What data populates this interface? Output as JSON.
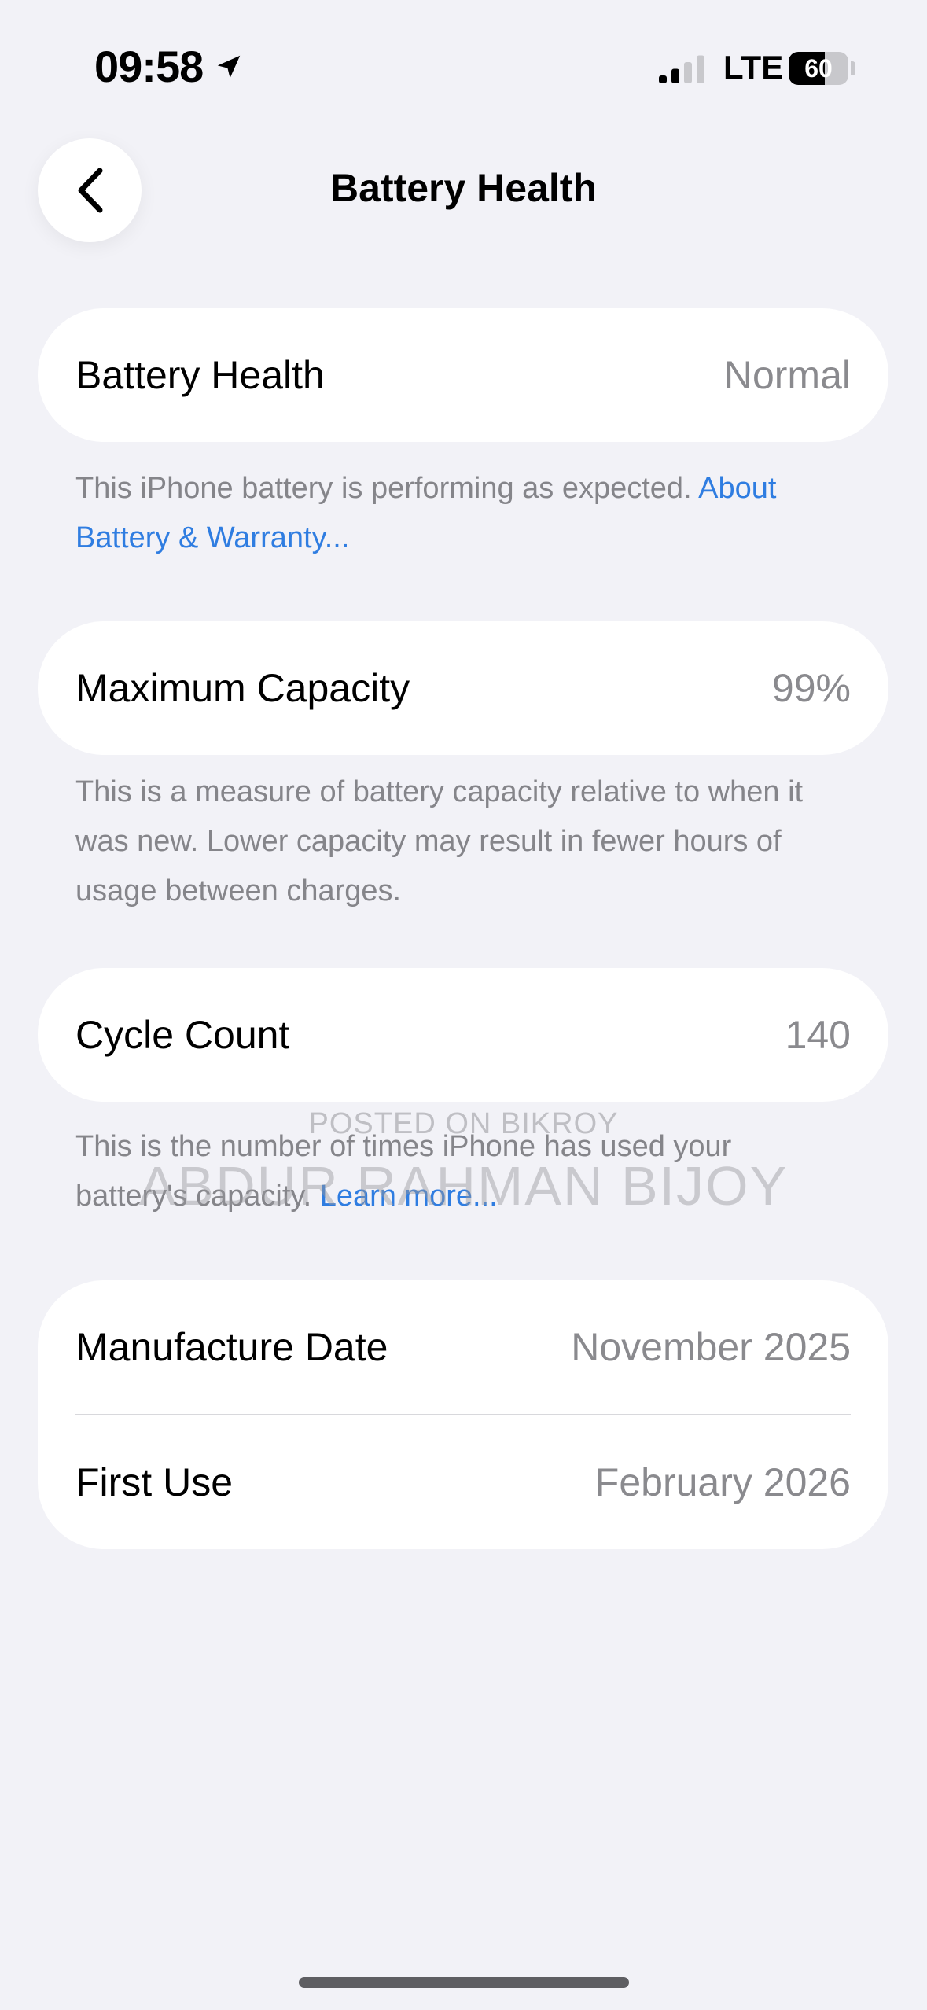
{
  "status_bar": {
    "time": "09:58",
    "network": "LTE",
    "battery_percent": "60",
    "battery_level": 0.6,
    "signal_bars_active": 2,
    "signal_bars_total": 4
  },
  "nav": {
    "title": "Battery Health",
    "back_icon": "chevron-left-icon"
  },
  "sections": {
    "health": {
      "label": "Battery Health",
      "value": "Normal",
      "footer_text": "This iPhone battery is performing as expected. ",
      "footer_link": "About Battery & Warranty..."
    },
    "capacity": {
      "label": "Maximum Capacity",
      "value": "99%",
      "footer_text": "This is a measure of battery capacity relative to when it was new. Lower capacity may result in fewer hours of usage between charges."
    },
    "cycles": {
      "label": "Cycle Count",
      "value": "140",
      "footer_text": "This is the number of times iPhone has used your battery's capacity. ",
      "footer_link": "Learn more..."
    },
    "dates": {
      "manufacture_label": "Manufacture Date",
      "manufacture_value": "November 2025",
      "first_use_label": "First Use",
      "first_use_value": "February 2026"
    }
  },
  "watermark": {
    "line1": "POSTED ON BIKROY",
    "line2": "ABDUR RAHMAN BIJOY"
  },
  "colors": {
    "background": "#f2f2f7",
    "card": "#ffffff",
    "link": "#2f7de1",
    "secondary_text": "#8a8a8e"
  }
}
